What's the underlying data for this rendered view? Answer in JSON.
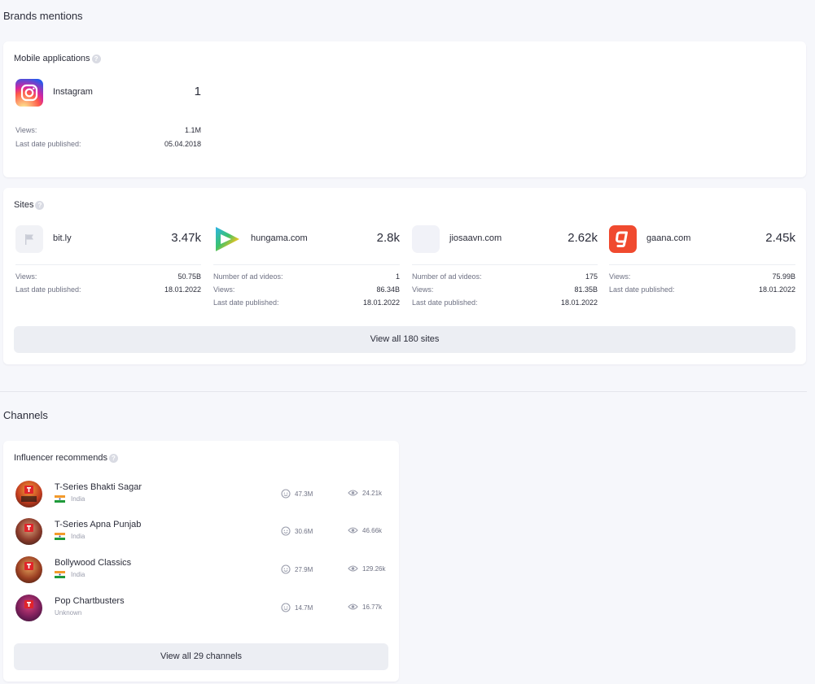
{
  "brands": {
    "title": "Brands mentions",
    "mobile": {
      "title": "Mobile applications",
      "help": "?",
      "items": [
        {
          "name": "Instagram",
          "count": "1",
          "views_label": "Views:",
          "views": "1.1M",
          "date_label": "Last date published:",
          "date": "05.04.2018"
        }
      ]
    },
    "sites": {
      "title": "Sites",
      "help": "?",
      "items": [
        {
          "name": "bit.ly",
          "count": "3.47k",
          "rows": [
            {
              "label": "Views:",
              "value": "50.75B"
            },
            {
              "label": "Last date published:",
              "value": "18.01.2022"
            }
          ]
        },
        {
          "name": "hungama.com",
          "count": "2.8k",
          "rows": [
            {
              "label": "Number of ad videos:",
              "value": "1"
            },
            {
              "label": "Views:",
              "value": "86.34B"
            },
            {
              "label": "Last date published:",
              "value": "18.01.2022"
            }
          ]
        },
        {
          "name": "jiosaavn.com",
          "count": "2.62k",
          "rows": [
            {
              "label": "Number of ad videos:",
              "value": "175"
            },
            {
              "label": "Views:",
              "value": "81.35B"
            },
            {
              "label": "Last date published:",
              "value": "18.01.2022"
            }
          ]
        },
        {
          "name": "gaana.com",
          "count": "2.45k",
          "rows": [
            {
              "label": "Views:",
              "value": "75.99B"
            },
            {
              "label": "Last date published:",
              "value": "18.01.2022"
            }
          ]
        }
      ],
      "view_all": "View all 180 sites"
    }
  },
  "channels": {
    "title": "Channels",
    "influencer": {
      "title": "Influencer recommends",
      "help": "?",
      "items": [
        {
          "name": "T-Series Bhakti Sagar",
          "country": "India",
          "subscribers": "47.3M",
          "views": "24.21k"
        },
        {
          "name": "T-Series Apna Punjab",
          "country": "India",
          "subscribers": "30.6M",
          "views": "46.66k"
        },
        {
          "name": "Bollywood Classics",
          "country": "India",
          "subscribers": "27.9M",
          "views": "129.26k"
        },
        {
          "name": "Pop Chartbusters",
          "country": "Unknown",
          "subscribers": "14.7M",
          "views": "16.77k"
        }
      ],
      "view_all": "View all 29 channels"
    }
  },
  "icons": {
    "instagram": "instagram-icon",
    "bitly": "flag-icon",
    "hungama": "play-triangle-icon",
    "gaana": "g-letter-icon",
    "subscribers": "smiley-face-icon",
    "views": "eye-icon"
  },
  "colors": {
    "background": "#f6f7fb",
    "card": "#ffffff",
    "button": "#eceef3",
    "gaana": "#f04a2f"
  }
}
